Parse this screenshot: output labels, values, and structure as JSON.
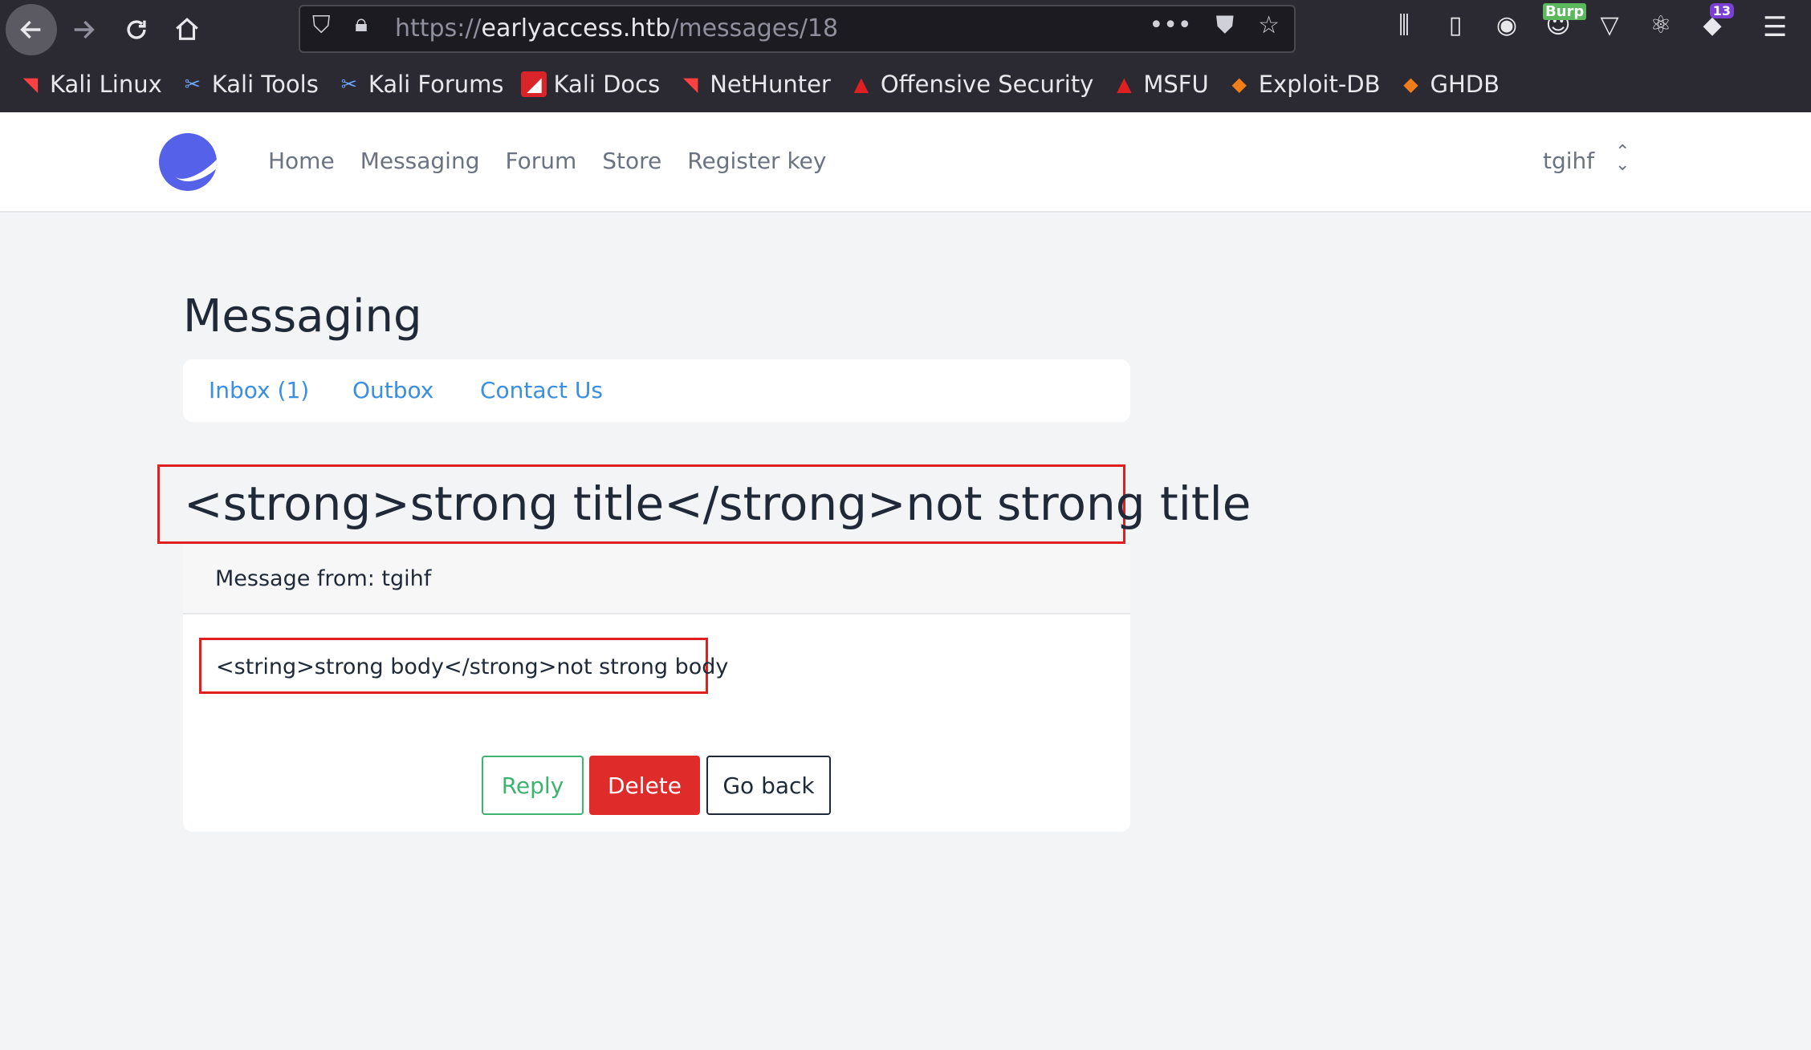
{
  "browser": {
    "url_scheme": "https://",
    "url_host": "earlyaccess.htb",
    "url_path": "/messages/18",
    "bookmarks": [
      {
        "label": "Kali Linux",
        "icon": "kali-dragon-icon"
      },
      {
        "label": "Kali Tools",
        "icon": "kali-tools-icon"
      },
      {
        "label": "Kali Forums",
        "icon": "kali-forums-icon"
      },
      {
        "label": "Kali Docs",
        "icon": "kali-docs-icon"
      },
      {
        "label": "NetHunter",
        "icon": "nethunter-icon"
      },
      {
        "label": "Offensive Security",
        "icon": "offsec-icon"
      },
      {
        "label": "MSFU",
        "icon": "msfu-icon"
      },
      {
        "label": "Exploit-DB",
        "icon": "exploit-db-icon"
      },
      {
        "label": "GHDB",
        "icon": "ghdb-icon"
      }
    ],
    "extensions": {
      "burp_label": "Burp",
      "badge_count": "13"
    }
  },
  "site": {
    "nav": {
      "home": "Home",
      "messaging": "Messaging",
      "forum": "Forum",
      "store": "Store",
      "register_key": "Register key"
    },
    "user": "tgihf"
  },
  "main": {
    "title": "Messaging",
    "tabs": {
      "inbox": "Inbox (1)",
      "outbox": "Outbox",
      "contact": "Contact Us"
    },
    "message": {
      "subject": "<strong>strong title</strong>not strong title",
      "from_label": "Message from: tgihf",
      "body": "<string>strong body</strong>not strong body"
    },
    "buttons": {
      "reply": "Reply",
      "delete": "Delete",
      "go_back": "Go back"
    }
  },
  "colors": {
    "accent_blue": "#3b8fe0",
    "delete_red": "#e02b2b",
    "reply_green": "#3cb371",
    "highlight_red": "#e02020"
  }
}
